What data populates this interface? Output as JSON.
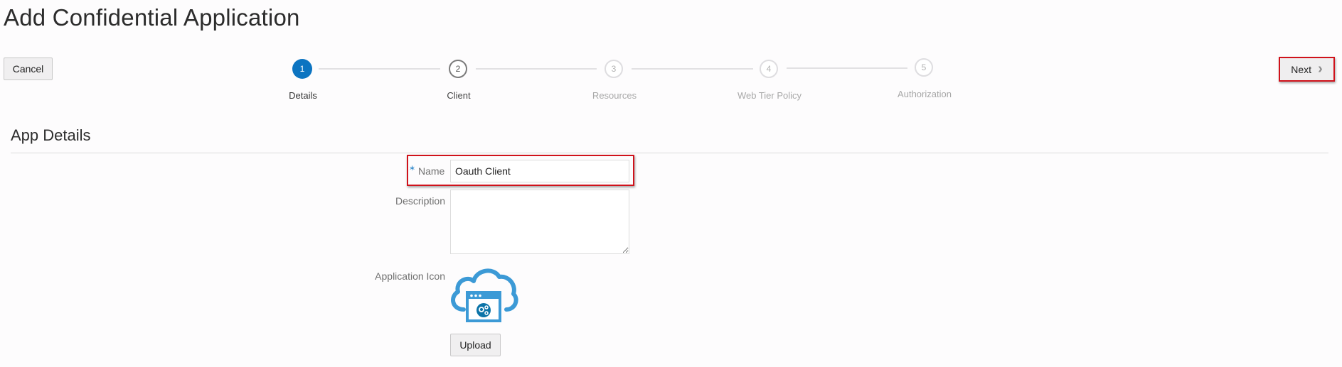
{
  "header": {
    "title": "Add Confidential Application"
  },
  "toolbar": {
    "cancel_label": "Cancel",
    "next_label": "Next",
    "next_icon": "chevron-right-icon"
  },
  "train": {
    "steps": [
      {
        "number": "1",
        "label": "Details",
        "state": "active"
      },
      {
        "number": "2",
        "label": "Client",
        "state": "visited"
      },
      {
        "number": "3",
        "label": "Resources",
        "state": "disabled"
      },
      {
        "number": "4",
        "label": "Web Tier Policy",
        "state": "disabled"
      },
      {
        "number": "5",
        "label": "Authorization",
        "state": "disabled"
      }
    ]
  },
  "section": {
    "title": "App Details"
  },
  "form": {
    "name": {
      "required_marker": "*",
      "label": "Name",
      "value": "Oauth Client"
    },
    "description": {
      "label": "Description",
      "value": ""
    },
    "app_icon": {
      "label": "Application Icon",
      "icon": "cloud-application-gear-icon",
      "upload_label": "Upload"
    }
  },
  "colors": {
    "accent": "#0c74c1",
    "highlight": "#d0121b",
    "icon_blue": "#3c9ad6"
  }
}
